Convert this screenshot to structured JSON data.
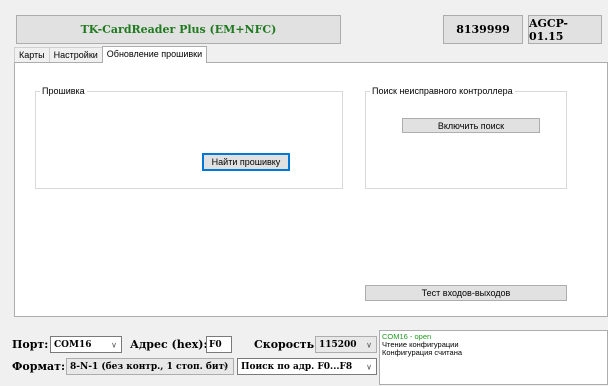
{
  "header": {
    "title": "TK-CardReader Plus (EM+NFC)",
    "serial": "8139999",
    "firmware": "AGCP-01.15"
  },
  "tabs": [
    {
      "label": "Карты"
    },
    {
      "label": "Настройки"
    },
    {
      "label": "Обновление прошивки"
    }
  ],
  "firmware_group": {
    "legend": "Прошивка",
    "find_button": "Найти прошивку"
  },
  "search_group": {
    "legend": "Поиск неисправного контроллера",
    "enable_button": "Включить поиск"
  },
  "io_test_button": "Тест входов-выходов",
  "bottom": {
    "port_label": "Порт:",
    "port_value": "COM16",
    "address_label": "Адрес (hex):",
    "address_value": "F0",
    "speed_label": "Скорость:",
    "speed_value": "115200",
    "format_label": "Формат:",
    "format_value": "8-N-1 (без контр., 1 стоп. бит)",
    "search_mode_value": "Поиск по адр. F0...F8"
  },
  "log": {
    "line1": "COM16 - open",
    "line2": "Чтение конфигурации",
    "line3": "Конфигурация считана"
  },
  "colors": {
    "title_text": "#1f7a1f",
    "log_open": "#1f9a1f",
    "focus_border": "#0078d7"
  }
}
